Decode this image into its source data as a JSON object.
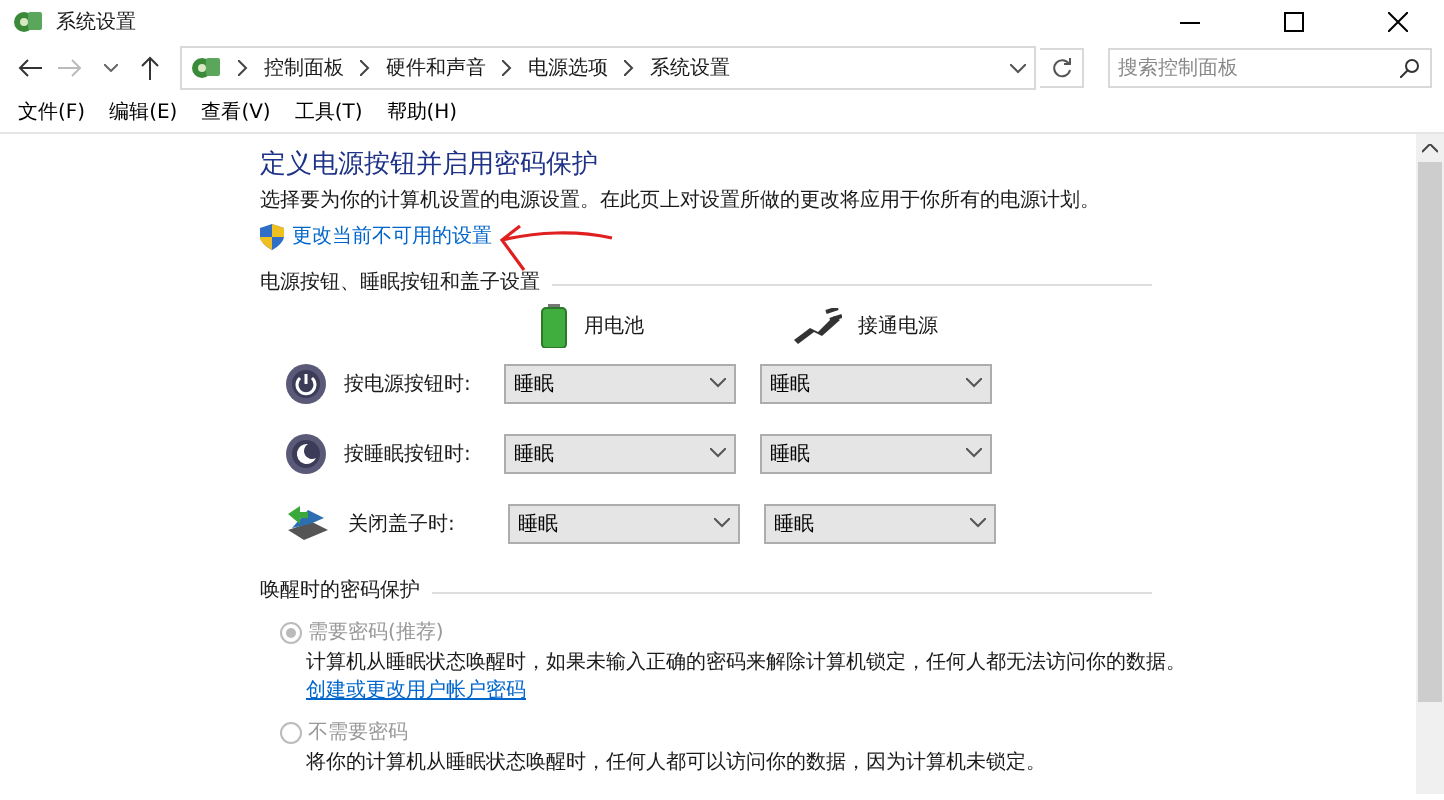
{
  "window": {
    "title": "系统设置"
  },
  "address": {
    "breadcrumbs": [
      "控制面板",
      "硬件和声音",
      "电源选项",
      "系统设置"
    ]
  },
  "search": {
    "placeholder": "搜索控制面板"
  },
  "menu": [
    "文件(F)",
    "编辑(E)",
    "查看(V)",
    "工具(T)",
    "帮助(H)"
  ],
  "page": {
    "heading": "定义电源按钮并启用密码保护",
    "description": "选择要为你的计算机设置的电源设置。在此页上对设置所做的更改将应用于你所有的电源计划。",
    "change_link": "更改当前不可用的设置"
  },
  "power_section": {
    "title": "电源按钮、睡眠按钮和盖子设置",
    "columns": [
      {
        "label": "用电池",
        "kind": "battery"
      },
      {
        "label": "接通电源",
        "kind": "plugged"
      }
    ],
    "rows": [
      {
        "label": "按电源按钮时:",
        "kind": "power",
        "values": [
          "睡眠",
          "睡眠"
        ]
      },
      {
        "label": "按睡眠按钮时:",
        "kind": "sleep",
        "values": [
          "睡眠",
          "睡眠"
        ]
      },
      {
        "label": "关闭盖子时:",
        "kind": "lid",
        "values": [
          "睡眠",
          "睡眠"
        ]
      }
    ]
  },
  "password_section": {
    "title": "唤醒时的密码保护",
    "options": [
      {
        "label": "需要密码(推荐)",
        "selected": true,
        "disabled": true,
        "description": "计算机从睡眠状态唤醒时，如果未输入正确的密码来解除计算机锁定，任何人都无法访问你的数据。",
        "link": "创建或更改用户帐户密码"
      },
      {
        "label": "不需要密码",
        "selected": false,
        "disabled": true,
        "description": "将你的计算机从睡眠状态唤醒时，任何人都可以访问你的数据，因为计算机未锁定。"
      }
    ]
  }
}
